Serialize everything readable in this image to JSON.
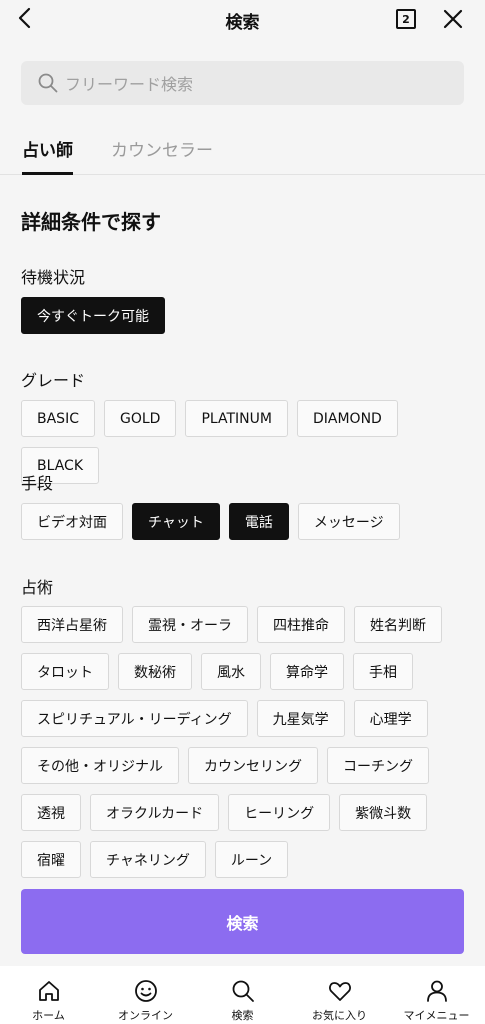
{
  "header": {
    "title": "検索",
    "tab_count": "2",
    "back_icon": "chevron-left-icon",
    "close_icon": "close-icon"
  },
  "search": {
    "placeholder": "フリーワード検索",
    "icon": "search-icon"
  },
  "tabs": [
    {
      "label": "占い師",
      "active": true
    },
    {
      "label": "カウンセラー",
      "active": false
    }
  ],
  "section_title": "詳細条件で探す",
  "filters": {
    "status": {
      "label": "待機状況",
      "options": [
        {
          "label": "今すぐトーク可能",
          "selected": true
        }
      ]
    },
    "grade": {
      "label": "グレード",
      "options": [
        {
          "label": "BASIC",
          "selected": false
        },
        {
          "label": "GOLD",
          "selected": false
        },
        {
          "label": "PLATINUM",
          "selected": false
        },
        {
          "label": "DIAMOND",
          "selected": false
        },
        {
          "label": "BLACK",
          "selected": false
        }
      ]
    },
    "method": {
      "label": "手段",
      "options": [
        {
          "label": "ビデオ対面",
          "selected": false
        },
        {
          "label": "チャット",
          "selected": true
        },
        {
          "label": "電話",
          "selected": true
        },
        {
          "label": "メッセージ",
          "selected": false
        }
      ]
    },
    "divination": {
      "label": "占術",
      "options": [
        {
          "label": "西洋占星術",
          "selected": false
        },
        {
          "label": "霊視・オーラ",
          "selected": false
        },
        {
          "label": "四柱推命",
          "selected": false
        },
        {
          "label": "姓名判断",
          "selected": false
        },
        {
          "label": "タロット",
          "selected": false
        },
        {
          "label": "数秘術",
          "selected": false
        },
        {
          "label": "風水",
          "selected": false
        },
        {
          "label": "算命学",
          "selected": false
        },
        {
          "label": "手相",
          "selected": false
        },
        {
          "label": "スピリチュアル・リーディング",
          "selected": false
        },
        {
          "label": "九星気学",
          "selected": false
        },
        {
          "label": "心理学",
          "selected": false
        },
        {
          "label": "その他・オリジナル",
          "selected": false
        },
        {
          "label": "カウンセリング",
          "selected": false
        },
        {
          "label": "コーチング",
          "selected": false
        },
        {
          "label": "透視",
          "selected": false
        },
        {
          "label": "オラクルカード",
          "selected": false
        },
        {
          "label": "ヒーリング",
          "selected": false
        },
        {
          "label": "紫微斗数",
          "selected": false
        },
        {
          "label": "宿曜",
          "selected": false
        },
        {
          "label": "チャネリング",
          "selected": false
        },
        {
          "label": "ルーン",
          "selected": false
        }
      ]
    }
  },
  "cta": {
    "label": "検索",
    "color": "#8c6cf0"
  },
  "bottom_nav": [
    {
      "label": "ホーム",
      "icon": "home-icon"
    },
    {
      "label": "オンライン",
      "icon": "smile-icon"
    },
    {
      "label": "検索",
      "icon": "search-icon"
    },
    {
      "label": "お気に入り",
      "icon": "heart-icon"
    },
    {
      "label": "マイメニュー",
      "icon": "user-icon"
    }
  ]
}
